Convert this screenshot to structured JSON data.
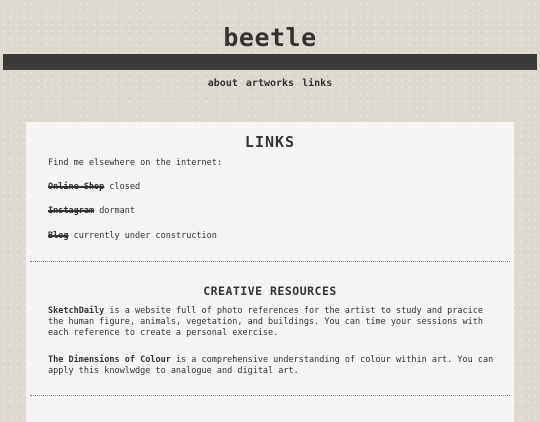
{
  "site": {
    "title": "beetle"
  },
  "nav": {
    "items": [
      "about",
      "artworks",
      "links"
    ]
  },
  "links_section": {
    "title": "LINKS",
    "intro": "Find me elsewhere on the internet:",
    "items": [
      {
        "label": "Online Shop",
        "status": "closed"
      },
      {
        "label": "Instagram",
        "status": "dormant"
      },
      {
        "label": "Blog",
        "status": "currently under construction"
      }
    ]
  },
  "resources_section": {
    "title": "CREATIVE RESOURCES",
    "items": [
      {
        "name": "SketchDaily",
        "description": "is a website full of photo references for the artist to study and pracice the human figure, animals, vegetation, and buildings. You can time your sessions with each reference to create a personal exercise."
      },
      {
        "name": "The Dimensions of Colour",
        "description": "is a comprehensive understanding of colour within art. You can apply this knowlwdge to analogue and digital art."
      }
    ]
  },
  "colors": {
    "background": "#ddd8d0",
    "bar": "#3a3a3a",
    "panel": "#f5f4f2",
    "text": "#333333"
  }
}
